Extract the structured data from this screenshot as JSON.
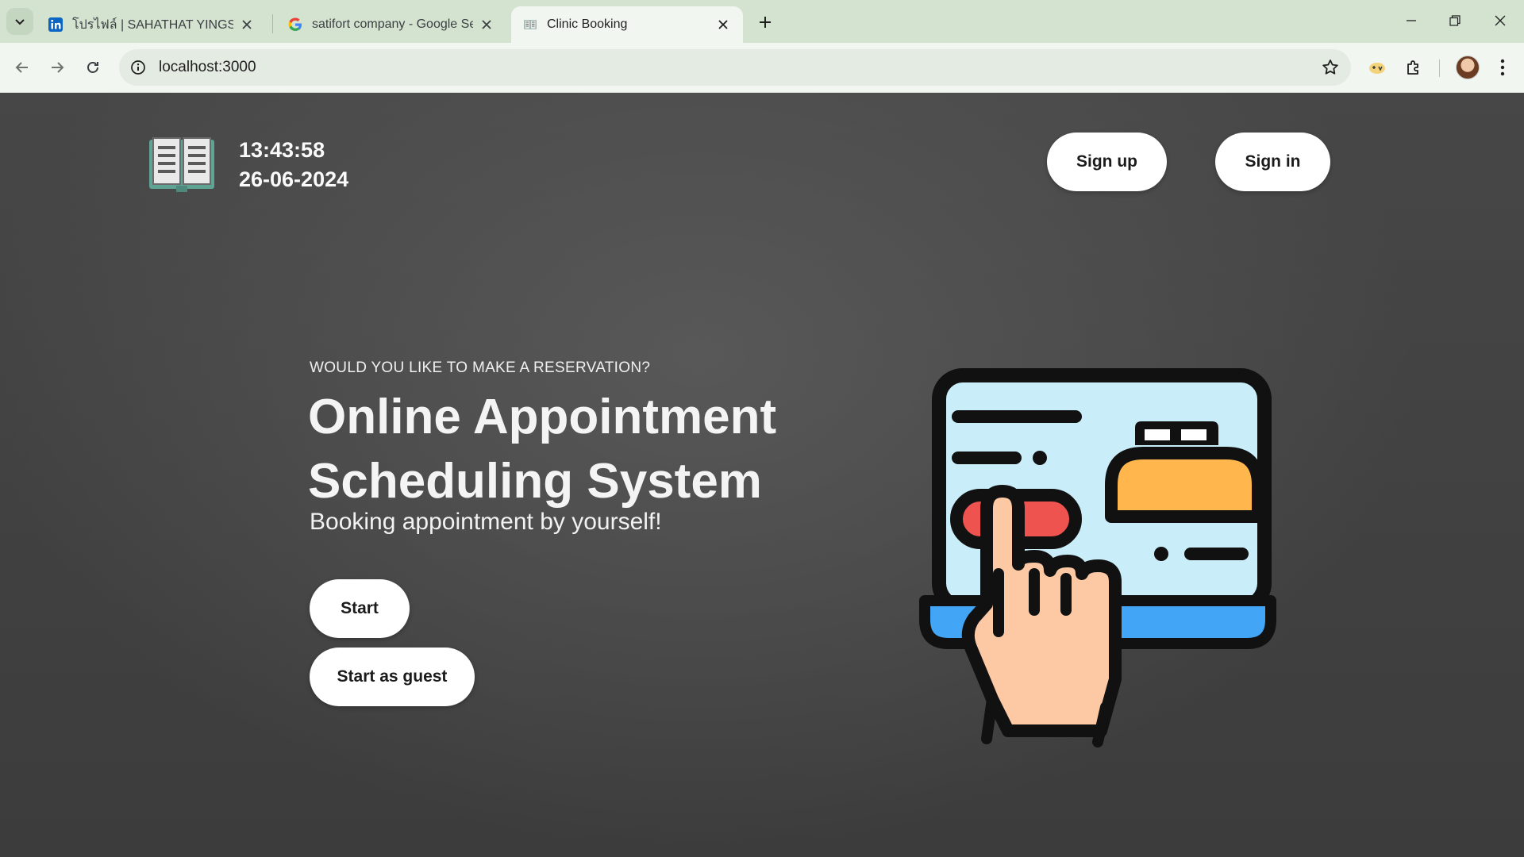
{
  "browser": {
    "tabs": [
      {
        "title": "โปรไฟล์ | SAHATHAT YINGSAKUL",
        "favicon": "linkedin-icon"
      },
      {
        "title": "satifort company - Google Search",
        "favicon": "google-icon"
      },
      {
        "title": "Clinic Booking",
        "favicon": "book-icon",
        "active": true
      }
    ],
    "url": "localhost:3000"
  },
  "header": {
    "time": "13:43:58",
    "date": "26-06-2024",
    "signup_label": "Sign up",
    "signin_label": "Sign in"
  },
  "hero": {
    "eyebrow": "WOULD YOU LIKE TO MAKE A RESERVATION?",
    "title_line1": "Online Appointment",
    "title_line2": "Scheduling System",
    "subtitle": "Booking appointment by yourself!",
    "start_label": "Start",
    "guest_label": "Start as guest",
    "illustration": "touch-screen-booking-illustration"
  },
  "colors": {
    "background": "#444444",
    "button": "#ffffff",
    "screen": "#c9eefa",
    "accent_red": "#ef5350",
    "accent_orange": "#ffb74d",
    "laptop_base": "#42a5f5",
    "skin": "#fdc9a4"
  }
}
